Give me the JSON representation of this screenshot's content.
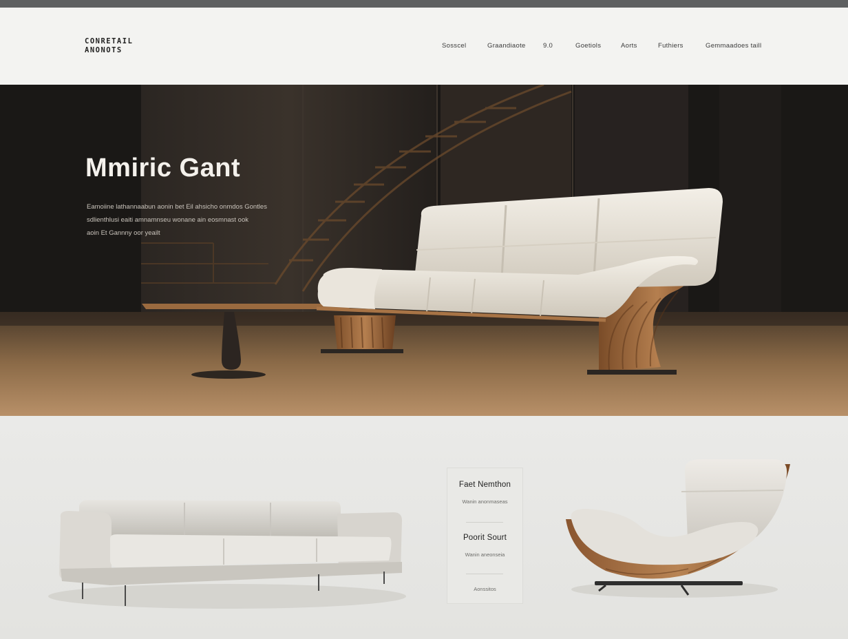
{
  "brand": {
    "line1": "CONRETAIL",
    "line2": "ANONOTS"
  },
  "nav": {
    "items": [
      {
        "label": "Sosscel"
      },
      {
        "label": "Graandiaote"
      },
      {
        "label": "9.0"
      },
      {
        "label": "Goetiols"
      },
      {
        "label": "Aorts"
      },
      {
        "label": "Futhiers"
      },
      {
        "label": "Gemmaadoes taill"
      }
    ]
  },
  "hero": {
    "title": "Mmiric Gant",
    "description_lines": [
      "Eamoiine lathannaabun aonin bet Eil ahsicho onmdos Gontles",
      "sdlienthlusi eaiti amnamnseu wonane ain eosmnast ook",
      "aoin Et Gannny oor yeailt"
    ]
  },
  "feature_card": {
    "title1": "Faet Nemthon",
    "sub1": "Wanin anonmaseas",
    "title2": "Poorit Sourt",
    "sub2": "Wanin aneonseia",
    "link": "Aonssitos"
  },
  "colors": {
    "header_bg": "#f3f3f1",
    "hero_dark": "#1d1b19",
    "wood": "#a87446",
    "leather": "#ece8df",
    "lower_bg": "#eaeae8"
  }
}
